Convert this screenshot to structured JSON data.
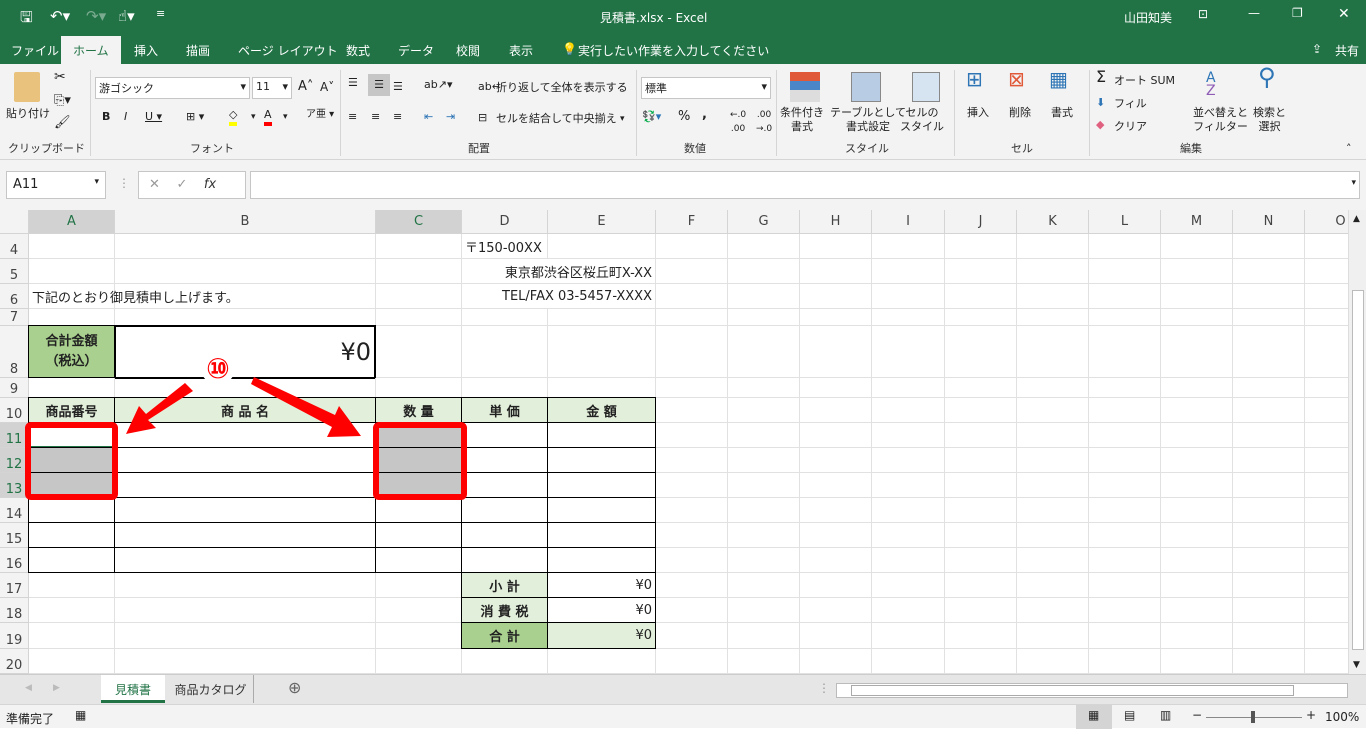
{
  "window": {
    "title": "見積書.xlsx  -  Excel",
    "user": "山田知美"
  },
  "ribbon_tabs": [
    "ファイル",
    "ホーム",
    "挿入",
    "描画",
    "ページ レイアウト",
    "数式",
    "データ",
    "校閲",
    "表示"
  ],
  "tell_me": "実行したい作業を入力してください",
  "share": "共有",
  "ribbon": {
    "paste": "貼り付け",
    "clipboard": "クリップボード",
    "font_name": "游ゴシック",
    "font_size": "11",
    "font": "フォント",
    "wrap": "折り返して全体を表示する",
    "merge": "セルを結合して中央揃え",
    "alignment": "配置",
    "number_format": "標準",
    "number": "数値",
    "cond_format": "条件付き\n書式",
    "table_format": "テーブルとして\n書式設定",
    "cell_style": "セルの\nスタイル",
    "styles": "スタイル",
    "insert": "挿入",
    "delete": "削除",
    "format": "書式",
    "cells": "セル",
    "autosum": "オート SUM",
    "fill": "フィル",
    "clear": "クリア",
    "sort": "並べ替えと\nフィルター",
    "find": "検索と\n選択",
    "editing": "編集",
    "highlight_color": "#ffff00",
    "font_color": "#ff0000"
  },
  "formula_bar": {
    "name_box": "A11",
    "fx": "fx",
    "formula": ""
  },
  "columns": [
    "A",
    "B",
    "C",
    "D",
    "E",
    "F",
    "G",
    "H",
    "I",
    "J",
    "K",
    "L",
    "M",
    "N",
    "O"
  ],
  "rows": [
    "4",
    "5",
    "6",
    "7",
    "8",
    "9",
    "10",
    "11",
    "12",
    "13",
    "14",
    "15",
    "16",
    "17",
    "18",
    "19",
    "20"
  ],
  "cells": [
    {
      "ref": "D4",
      "text": "〒150-00XX"
    },
    {
      "ref": "D5",
      "text": "東京都渋谷区桜丘町X-XX"
    },
    {
      "ref": "A6",
      "text": "下記のとおり御見積申し上げます。"
    },
    {
      "ref": "D6",
      "text": "TEL/FAX 03-5457-XXXX"
    },
    {
      "ref": "A8",
      "text": "合計金額\n（税込）"
    },
    {
      "ref": "B8",
      "text": "¥0"
    },
    {
      "ref": "A10",
      "text": "商品番号"
    },
    {
      "ref": "B10",
      "text": "商 品 名"
    },
    {
      "ref": "C10",
      "text": "数 量"
    },
    {
      "ref": "D10",
      "text": "単 価"
    },
    {
      "ref": "E10",
      "text": "金 額"
    },
    {
      "ref": "D17",
      "text": "小 計"
    },
    {
      "ref": "E17",
      "text": "¥0"
    },
    {
      "ref": "D18",
      "text": "消 費 税"
    },
    {
      "ref": "E18",
      "text": "¥0"
    },
    {
      "ref": "D19",
      "text": "合 計"
    },
    {
      "ref": "E19",
      "text": "¥0"
    }
  ],
  "annotation": {
    "label": "⑩",
    "color": "#ff0000"
  },
  "sheets": [
    {
      "name": "見積書",
      "active": true
    },
    {
      "name": "商品カタログ",
      "active": false
    }
  ],
  "status": {
    "ready": "準備完了",
    "zoom": "100%"
  }
}
